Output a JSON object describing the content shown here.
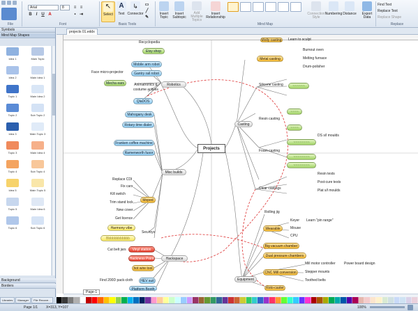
{
  "ribbon": {
    "font_name": "Arial",
    "font_size": "8",
    "groups": [
      "File",
      "Font",
      "Basic Tools",
      "Mind Map",
      "Replace"
    ],
    "buttons": {
      "select": "Select",
      "text": "Text",
      "connector": "Connector",
      "insert_topic": "Insert Topic",
      "insert_subtopic": "Insert Subtopic",
      "add_multiple": "Add Multiple Topics",
      "insert_relationship": "Insert Relationship",
      "connection_style": "Connection Style",
      "numbering": "Numbering",
      "distance": "Distance",
      "export_data": "Export Data",
      "find_text": "Find Text",
      "replace_text": "Replace Text",
      "replace_shape": "Replace Shape"
    }
  },
  "left_panel": {
    "title": "Symbols",
    "section": "Mind Map Shapes",
    "shapes": [
      {
        "label": "Idea 1",
        "color": "#8fb2e0"
      },
      {
        "label": "Main Topic",
        "color": "#b7c9e6"
      },
      {
        "label": "Idea 2",
        "color": "#a9c3ea"
      },
      {
        "label": "Main Idea 1",
        "color": "#cfdcf0"
      },
      {
        "label": "Topic 1",
        "color": "#3f74c9"
      },
      {
        "label": "Main Idea 2",
        "color": "#d9e6f6"
      },
      {
        "label": "Topic 2",
        "color": "#5a8bd6"
      },
      {
        "label": "Sub Topic 2",
        "color": "#d4e2f5"
      },
      {
        "label": "Idea 3",
        "color": "#2b5fae"
      },
      {
        "label": "Main Topic 3",
        "color": "#e0ebf8"
      },
      {
        "label": "Topic 3",
        "color": "#f08a5c"
      },
      {
        "label": "Main Idea 4",
        "color": "#f6b08a"
      },
      {
        "label": "Topic 4",
        "color": "#f4a460"
      },
      {
        "label": "Sub Topic 4",
        "color": "#f8c79a"
      },
      {
        "label": "Idea 5",
        "color": "#f7d36b"
      },
      {
        "label": "Main Topic 5",
        "color": "#f9e6a9"
      },
      {
        "label": "Topic 5",
        "color": "#c7d7ee"
      },
      {
        "label": "Main Idea 6",
        "color": "#dfe8f5"
      },
      {
        "label": "Topic 6",
        "color": "#b0c7ea"
      },
      {
        "label": "Sub Topic 6",
        "color": "#d6e3f5"
      }
    ],
    "bottom_sections": [
      "Background",
      "Borders"
    ]
  },
  "document": {
    "tab_title": "projects 01.eddx",
    "page_tab": "Page-1"
  },
  "mindmap": {
    "center": "Projects",
    "branches": {
      "robotics": "Robotics",
      "misc": "Misc builds",
      "hackspace": "Hackspace",
      "casting": "Casting",
      "equipment": "Equipment"
    },
    "left_nodes": {
      "recycle": "Recyclopedia",
      "etsy": "Etsy shop",
      "mobile_arm": "Mobile arm robot",
      "gantry": "Gantry rail robot",
      "face_proj": "Face micro-projector",
      "mecha": "Mecha ears",
      "animatronics": "Animatronics &\ncostume actives",
      "qlcog": "QlaDOS",
      "mahogany": "Mahogany desk",
      "rotary": "Rotary time dialer",
      "franken": "Franken coffee machine",
      "ramen": "Ramenworth fusor",
      "replace_cdi": "Replace CDI",
      "fix_cars": "Fix cars",
      "kill_switch": "Kill switch",
      "trim_stand": "Trim stand lock",
      "new_cover": "New cover",
      "get_licence": "Get licence",
      "moped": "Moped",
      "harmony": "Harmony vibe",
      "sex_toys": "Sex toys",
      "blurred_misc": "Bbbbbbbbbbbb",
      "cut_belt": "Cut belt jars",
      "vinyl": "Vinyl station",
      "hackness": "Hackness Point",
      "hot_wire": "hot wire tool",
      "find_200d": "Find 200D pack-cloth",
      "hev": "HEV suit",
      "ppiece": "Platform Booth"
    },
    "right_nodes": {
      "top_node": "Molly casting",
      "top_text": "Learn to sculpt",
      "metal_casting": "Metal casting",
      "burnout": "Burnout oven",
      "melting": "Melting furnace",
      "drum": "Drum-polisher",
      "silicone": "Silicone casting",
      "resin": "Resin casting",
      "ds_mould": "DS s/l moulds",
      "foam": "Foam casting",
      "clear": "Clear castings",
      "resin_tests": "Resin tests",
      "post_cure": "Post-cure tests",
      "plat_mould": "Plat s/l moulds",
      "rolling_jig": "Rolling jig",
      "wearable": "Wearable",
      "keyer": "Keyer",
      "learn_pin": "Learn \"pin range\"",
      "mouse": "Mouse",
      "cpu": "CPU",
      "big_vac": "Big vacuum chamber",
      "dual_press": "Dual pressure chambers",
      "cnc": "CNC Mill conversion",
      "mill_motor": "Mill motor controller",
      "power_board": "Power board design",
      "stepper": "Stepper mounts",
      "toothed": "Toothed belts",
      "rota": "Roto-caster"
    }
  },
  "status_bar": {
    "page": "Page 1/1",
    "coords": "X=313, Y=107",
    "zoom": "100%"
  },
  "bottom_tabs": [
    "Libraries",
    "Manager",
    "File Recove..."
  ],
  "palette": [
    "#000000",
    "#3a3a3a",
    "#7a7a7a",
    "#b0b0b0",
    "#ffffff",
    "#c00000",
    "#ff0000",
    "#ff6600",
    "#ffc000",
    "#ffff00",
    "#92d050",
    "#00b050",
    "#00b0f0",
    "#0070c0",
    "#002060",
    "#7030a0",
    "#ff99cc",
    "#ffcc99",
    "#ffff99",
    "#ccffcc",
    "#ccffff",
    "#99ccff",
    "#cc99ff",
    "#993366",
    "#996633",
    "#669933",
    "#339966",
    "#336699",
    "#663399",
    "#cc3333",
    "#cc6633",
    "#cccc33",
    "#33cc66",
    "#33cccc",
    "#3366cc",
    "#9933cc",
    "#ff3366",
    "#ff9933",
    "#66ff33",
    "#33ffcc",
    "#33ccff",
    "#6633ff",
    "#ff33cc",
    "#aa0000",
    "#aa5500",
    "#aaaa00",
    "#00aa55",
    "#00aaaa",
    "#0055aa",
    "#5500aa",
    "#aa0055",
    "#e6b8af",
    "#f4cccc",
    "#fce5cd",
    "#fff2cc",
    "#d9ead3",
    "#d0e0e3",
    "#c9daf8",
    "#cfe2f3",
    "#d9d2e9",
    "#ead1dc"
  ]
}
